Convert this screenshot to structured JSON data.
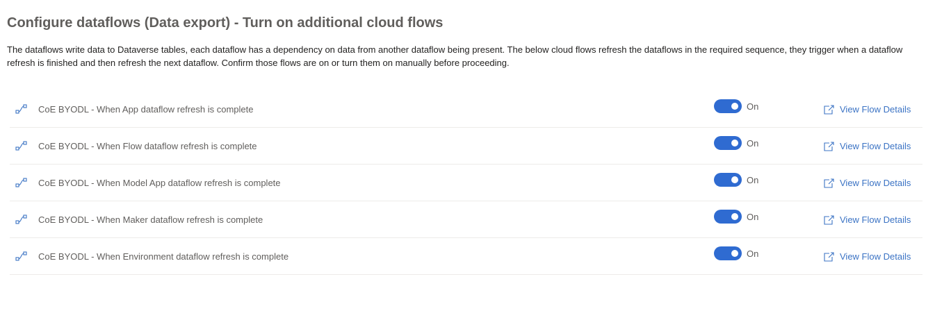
{
  "header": {
    "title": "Configure dataflows (Data export) - Turn on additional cloud flows",
    "description": "The dataflows write data to Dataverse tables, each dataflow has a dependency on data from another dataflow being present. The below cloud flows refresh the dataflows in the required sequence, they trigger when a dataflow refresh is finished and then refresh the next dataflow. Confirm those flows are on or turn them on manually before proceeding."
  },
  "colors": {
    "accent": "#2f6bd1",
    "link": "#3b73c4",
    "divider": "#edebe9"
  },
  "flows": [
    {
      "name": "CoE BYODL - When App dataflow refresh is complete",
      "enabled": true,
      "state_label": "On",
      "link_label": "View Flow Details",
      "icon": "flow-icon"
    },
    {
      "name": "CoE BYODL - When Flow dataflow refresh is complete",
      "enabled": true,
      "state_label": "On",
      "link_label": "View Flow Details",
      "icon": "flow-icon"
    },
    {
      "name": "CoE BYODL - When Model App dataflow refresh is complete",
      "enabled": true,
      "state_label": "On",
      "link_label": "View Flow Details",
      "icon": "flow-icon"
    },
    {
      "name": "CoE BYODL - When Maker dataflow refresh is complete",
      "enabled": true,
      "state_label": "On",
      "link_label": "View Flow Details",
      "icon": "flow-icon"
    },
    {
      "name": "CoE BYODL - When Environment dataflow refresh is complete",
      "enabled": true,
      "state_label": "On",
      "link_label": "View Flow Details",
      "icon": "flow-icon"
    }
  ]
}
